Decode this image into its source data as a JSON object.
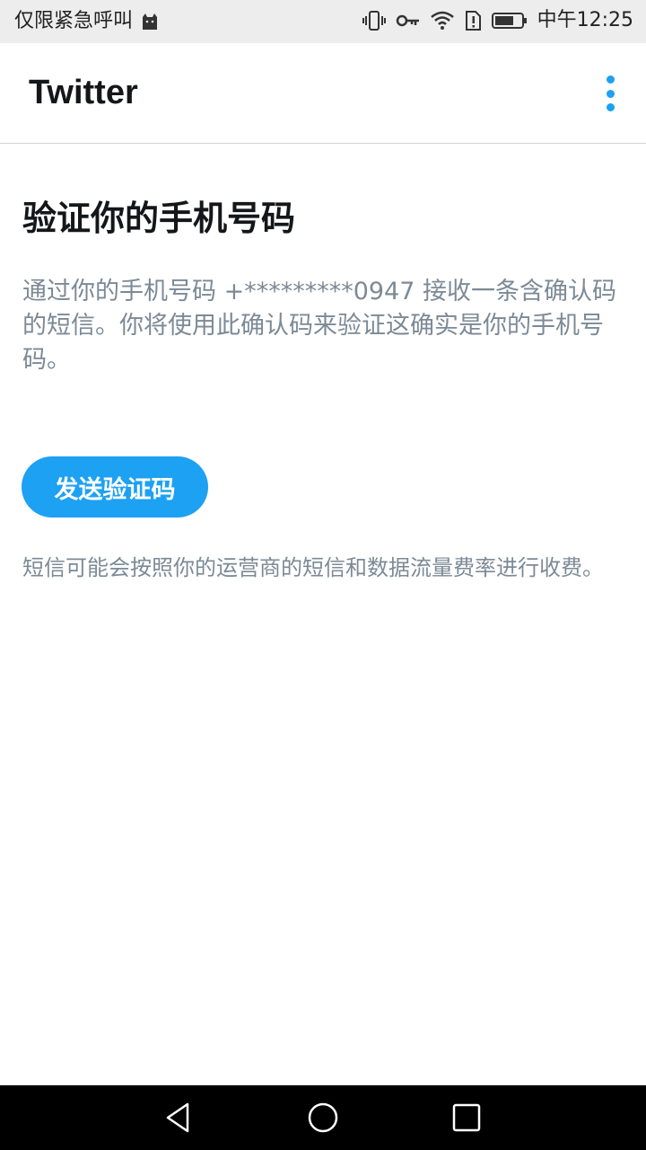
{
  "status_bar": {
    "carrier_text": "仅限紧急呼叫",
    "time": "中午12:25",
    "icons": [
      "cat-icon",
      "vibrate-icon",
      "key-icon",
      "wifi-icon",
      "sim-alert-icon",
      "battery-icon"
    ]
  },
  "app_bar": {
    "title": "Twitter",
    "menu_icon": "more-vert-icon"
  },
  "main": {
    "heading": "验证你的手机号码",
    "description": "通过你的手机号码 +*********0947 接收一条含确认码的短信。你将使用此确认码来验证这确实是你的手机号码。",
    "send_button_label": "发送验证码",
    "disclaimer": "短信可能会按照你的运营商的短信和数据流量费率进行收费。"
  },
  "nav_bar": {
    "icons": [
      "back-icon",
      "home-icon",
      "recents-icon"
    ]
  },
  "colors": {
    "accent": "#1da1f2",
    "text_primary": "#14171a",
    "text_secondary": "#7c8a96",
    "status_bar_bg": "#ededed",
    "nav_bar_bg": "#000000"
  }
}
